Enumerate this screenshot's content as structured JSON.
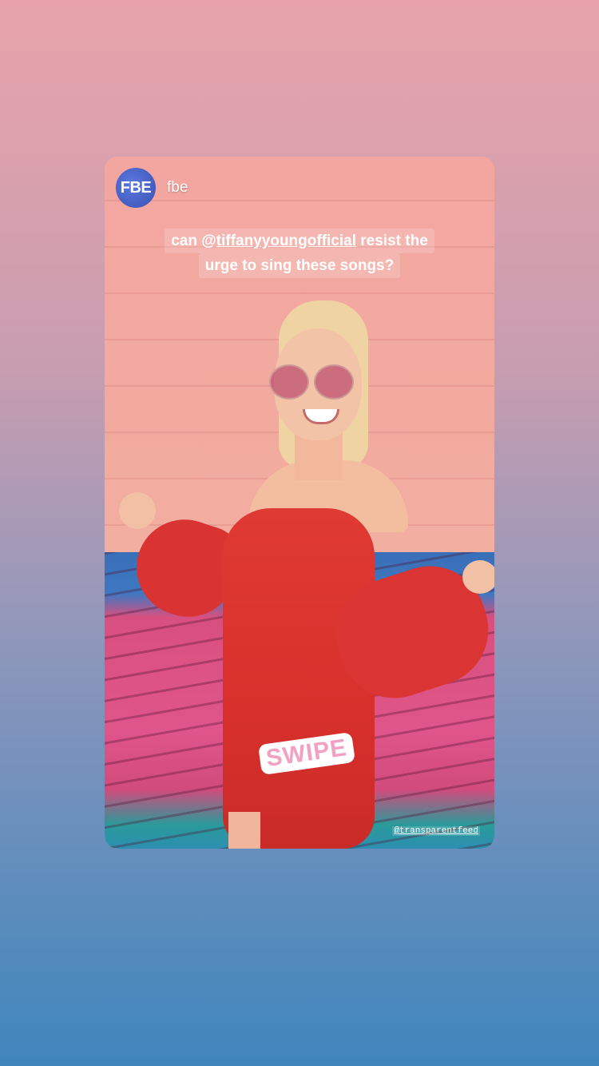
{
  "story": {
    "account": {
      "avatar_text": "FBE",
      "username": "fbe"
    },
    "caption": {
      "line1_prefix": "can @",
      "mention": "tiffanyyoungofficial",
      "line1_suffix": " resist the",
      "line2": "urge to sing these songs?"
    },
    "sticker_text": "SWIPE",
    "credit": "@transparentfeed"
  },
  "colors": {
    "avatar": "#3a4fb0",
    "dress": "#d8302c",
    "sticker_text": "#f2a0c4"
  }
}
